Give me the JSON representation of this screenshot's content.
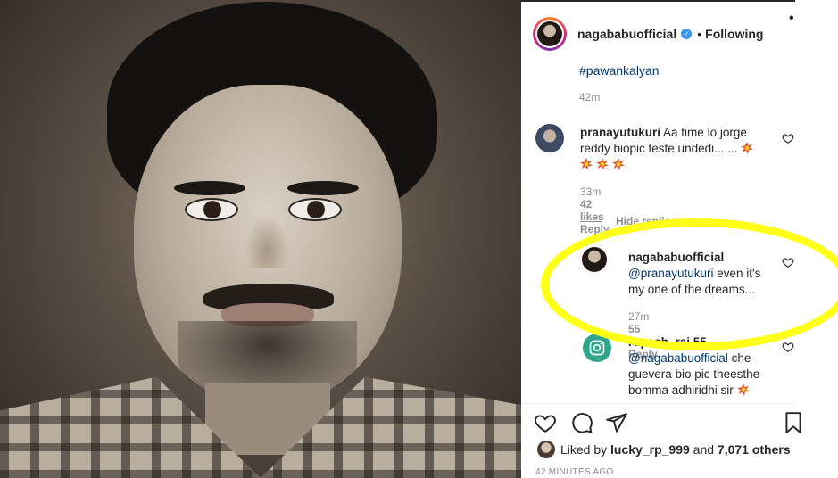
{
  "post": {
    "username": "nagababuofficial",
    "dot": "•",
    "follow_state": "Following",
    "more": "•"
  },
  "caption": {
    "hashtag": "#pawankalyan",
    "time": "42m"
  },
  "comments": [
    {
      "username": "pranayutukuri",
      "text": "Aa time lo jorge reddy biopic teste undedi.......",
      "time": "33m",
      "likes": "42 likes",
      "reply": "Reply"
    }
  ],
  "hide_replies": "Hide replies",
  "replies": [
    {
      "username": "nagababuofficial",
      "mention": "@pranayutukuri",
      "text": "even it's my one of the dreams...",
      "time": "27m",
      "likes": "55 likes",
      "reply": "Reply"
    },
    {
      "username": "rupesh_raj.55",
      "mention": "@nagababuofficial",
      "text": "che guevera bio pic theesthe bomma adhiridhi sir"
    }
  ],
  "likes": {
    "prefix": "Liked by",
    "user": "lucky_rp_999",
    "and": "and",
    "others": "7,071 others"
  },
  "posted": "42 MINUTES AGO",
  "colors": {
    "link": "#00376b",
    "muted": "#8e8e8e",
    "verified": "#3897f0",
    "highlight": "#ffff17"
  }
}
